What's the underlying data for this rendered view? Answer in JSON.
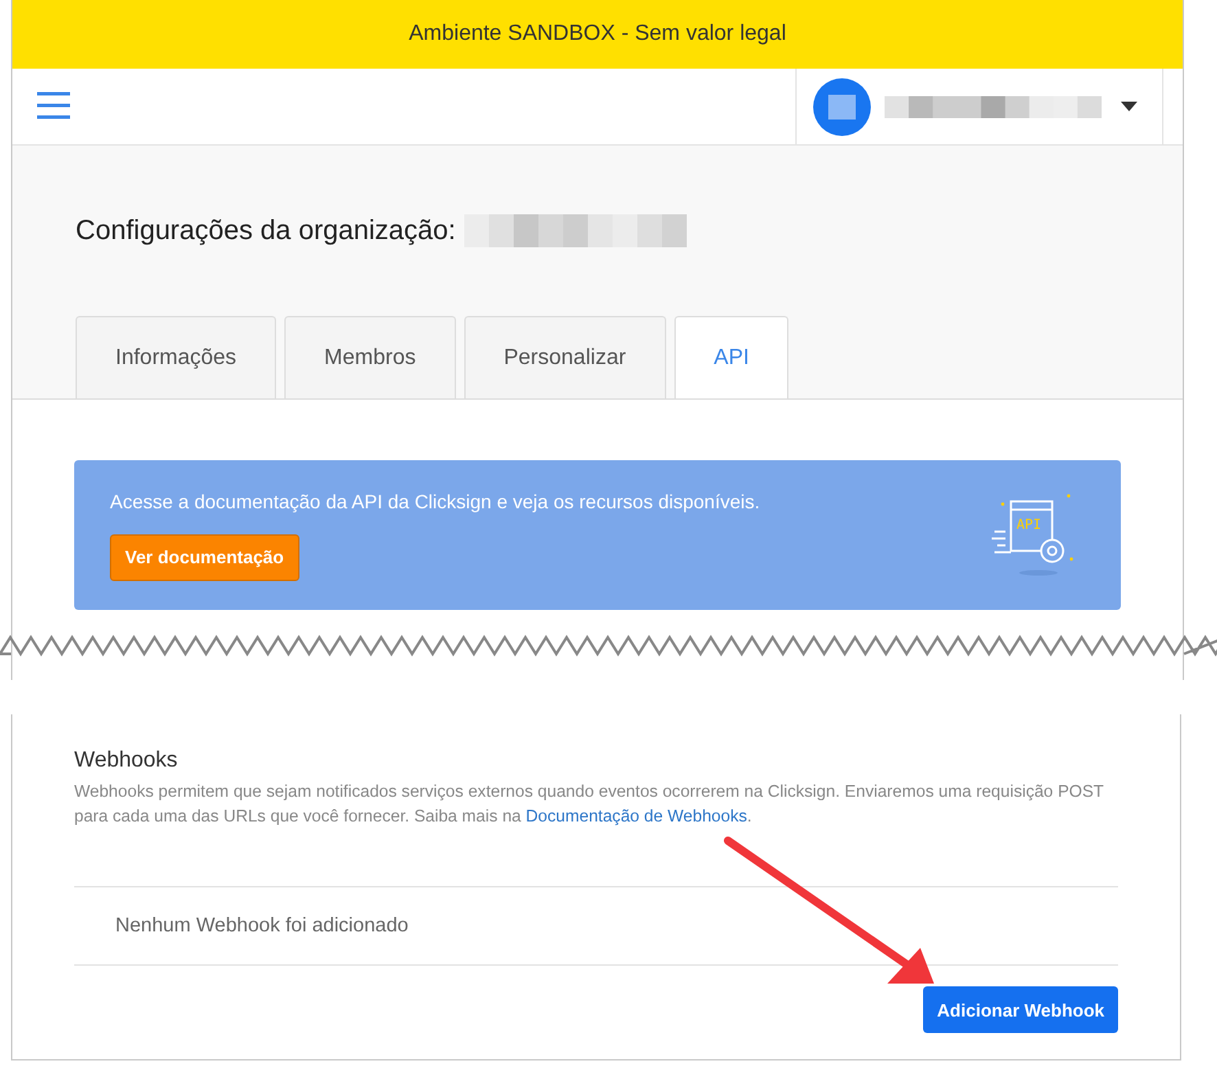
{
  "sandbox_banner": "Ambiente SANDBOX - Sem valor legal",
  "header": {
    "user_menu": {
      "expanded": false
    }
  },
  "page_title": "Configurações da organização:",
  "tabs": [
    {
      "label": "Informações",
      "selected": false
    },
    {
      "label": "Membros",
      "selected": false
    },
    {
      "label": "Personalizar",
      "selected": false
    },
    {
      "label": "API",
      "selected": true
    }
  ],
  "api_banner": {
    "text": "Acesse a documentação da API da Clicksign e veja os recursos disponíveis.",
    "button": "Ver documentação",
    "icon_label": "API"
  },
  "webhooks": {
    "title": "Webhooks",
    "description": "Webhooks permitem que sejam notificados serviços externos quando eventos ocorrerem na Clicksign. Enviaremos uma requisição POST para cada uma das URLs que você fornecer. Saiba mais na",
    "link": "Documentação de Webhooks",
    "link_suffix": ".",
    "empty_message": "Nenhum Webhook foi adicionado",
    "button": "Adicionar Webhook"
  }
}
